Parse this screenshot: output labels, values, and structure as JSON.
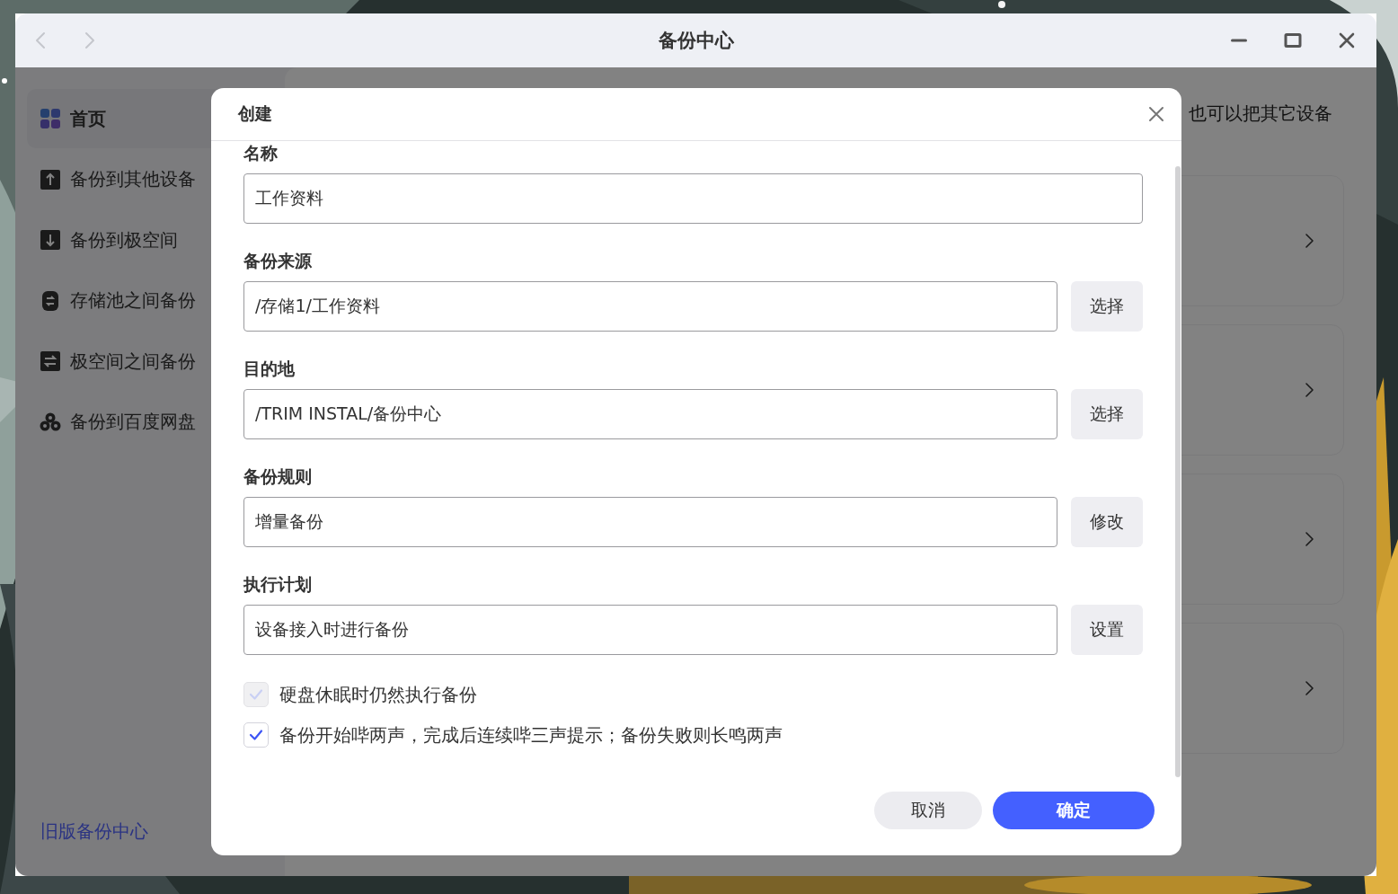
{
  "window": {
    "title": "备份中心",
    "nav": [
      {
        "kind": "back",
        "disabled": true
      },
      {
        "kind": "forward",
        "disabled": true
      }
    ]
  },
  "sidebar": {
    "items": [
      {
        "label": "首页",
        "selected": true
      },
      {
        "label": "备份到其他设备",
        "selected": false
      },
      {
        "label": "备份到极空间",
        "selected": false
      },
      {
        "label": "存储池之间备份",
        "selected": false
      },
      {
        "label": "极空间之间备份",
        "selected": false
      },
      {
        "label": "备份到百度网盘",
        "selected": false
      }
    ],
    "footer_link": "旧版备份中心"
  },
  "main": {
    "heading": "也可以把其它设备",
    "cards": [
      {
        "arrow": true
      },
      {
        "arrow": true
      },
      {
        "arrow": true
      },
      {
        "arrow": true
      }
    ]
  },
  "dialog": {
    "title": "创建",
    "fields": [
      {
        "label": "名称",
        "value": "工作资料"
      },
      {
        "label": "备份来源",
        "value": "/存储1/工作资料",
        "button": "选择"
      },
      {
        "label": "目的地",
        "value": "/TRIM INSTAL/备份中心",
        "button": "选择"
      },
      {
        "label": "备份规则",
        "value": "增量备份",
        "button": "修改"
      },
      {
        "label": "执行计划",
        "value": "设备接入时进行备份",
        "button": "设置"
      }
    ],
    "options": [
      {
        "label": "硬盘休眠时仍然执行备份",
        "checked": true,
        "disabled": true
      },
      {
        "label": "备份开始哔两声，完成后连续哔三声提示；备份失败则长鸣两声",
        "checked": true,
        "disabled": false
      }
    ],
    "buttons": [
      {
        "label": "取消",
        "kind": "secondary"
      },
      {
        "label": "确定",
        "kind": "primary"
      }
    ]
  }
}
